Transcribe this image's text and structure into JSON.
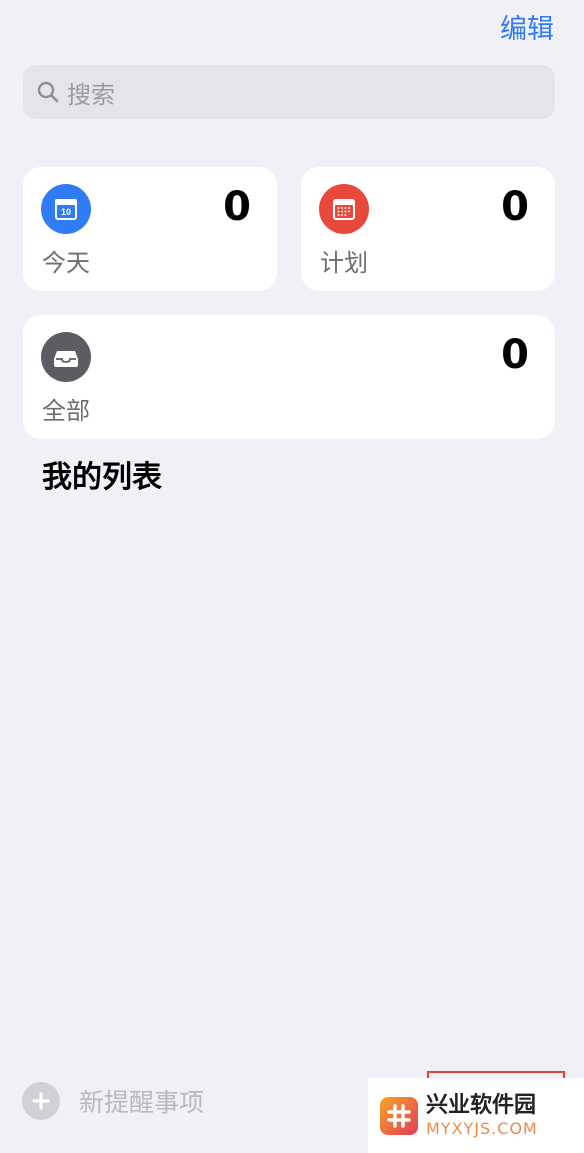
{
  "header": {
    "edit_label": "编辑"
  },
  "search": {
    "placeholder": "搜索"
  },
  "smart_lists": [
    {
      "id": "today",
      "label": "今天",
      "count": "0",
      "icon": "calendar-today-icon",
      "color": "#2f7cf6",
      "day": "10"
    },
    {
      "id": "scheduled",
      "label": "计划",
      "count": "0",
      "icon": "calendar-grid-icon",
      "color": "#e8493d"
    },
    {
      "id": "all",
      "label": "全部",
      "count": "0",
      "icon": "tray-icon",
      "color": "#5b5d63"
    }
  ],
  "my_lists": {
    "title": "我的列表"
  },
  "footer": {
    "new_reminder_label": "新提醒事项"
  },
  "watermark": {
    "cn": "兴业软件园",
    "en": "MYXYJS.COM"
  }
}
